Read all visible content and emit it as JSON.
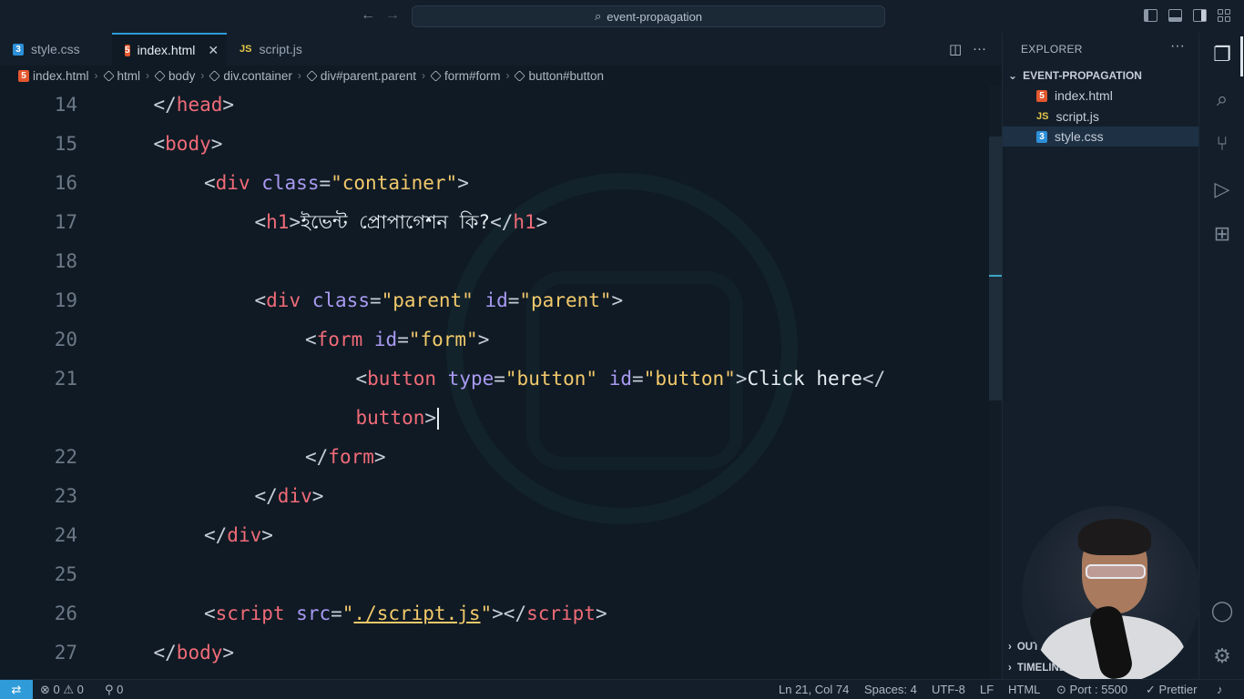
{
  "titlebar": {
    "search_text": "event-propagation"
  },
  "tabs": [
    {
      "label": "style.css",
      "icon": "css-file-icon"
    },
    {
      "label": "index.html",
      "icon": "html-file-icon",
      "active": true
    },
    {
      "label": "script.js",
      "icon": "js-file-icon"
    }
  ],
  "icons": {
    "html_glyph": "5",
    "css_glyph": "3",
    "js_glyph": "JS"
  },
  "breadcrumb": [
    "index.html",
    "html",
    "body",
    "div.container",
    "div#parent.parent",
    "form#form",
    "button#button"
  ],
  "editor": {
    "lines": [
      {
        "n": "14",
        "indent": 1,
        "tokens": [
          [
            "p",
            "</"
          ],
          [
            "t",
            "head"
          ],
          [
            "p",
            ">"
          ]
        ]
      },
      {
        "n": "15",
        "indent": 1,
        "tokens": [
          [
            "p",
            "<"
          ],
          [
            "t",
            "body"
          ],
          [
            "p",
            ">"
          ]
        ]
      },
      {
        "n": "16",
        "indent": 2,
        "tokens": [
          [
            "p",
            "<"
          ],
          [
            "t",
            "div"
          ],
          [
            "p",
            " "
          ],
          [
            "a",
            "class"
          ],
          [
            "p",
            "="
          ],
          [
            "s",
            "\"container\""
          ],
          [
            "p",
            ">"
          ]
        ]
      },
      {
        "n": "17",
        "indent": 3,
        "tokens": [
          [
            "p",
            "<"
          ],
          [
            "t",
            "h1"
          ],
          [
            "p",
            ">"
          ],
          [
            "x",
            "ইভেন্ট প্রোপাগেশন কি?"
          ],
          [
            "p",
            "</"
          ],
          [
            "t",
            "h1"
          ],
          [
            "p",
            ">"
          ]
        ]
      },
      {
        "n": "18",
        "indent": 0,
        "tokens": []
      },
      {
        "n": "19",
        "indent": 3,
        "tokens": [
          [
            "p",
            "<"
          ],
          [
            "t",
            "div"
          ],
          [
            "p",
            " "
          ],
          [
            "a",
            "class"
          ],
          [
            "p",
            "="
          ],
          [
            "s",
            "\"parent\""
          ],
          [
            "p",
            " "
          ],
          [
            "a",
            "id"
          ],
          [
            "p",
            "="
          ],
          [
            "s",
            "\"parent\""
          ],
          [
            "p",
            ">"
          ]
        ]
      },
      {
        "n": "20",
        "indent": 4,
        "tokens": [
          [
            "p",
            "<"
          ],
          [
            "t",
            "form"
          ],
          [
            "p",
            " "
          ],
          [
            "a",
            "id"
          ],
          [
            "p",
            "="
          ],
          [
            "s",
            "\"form\""
          ],
          [
            "p",
            ">"
          ]
        ]
      },
      {
        "n": "21",
        "indent": 5,
        "tokens": [
          [
            "p",
            "<"
          ],
          [
            "t",
            "button"
          ],
          [
            "p",
            " "
          ],
          [
            "a",
            "type"
          ],
          [
            "p",
            "="
          ],
          [
            "s",
            "\"button\""
          ],
          [
            "p",
            " "
          ],
          [
            "a",
            "id"
          ],
          [
            "p",
            "="
          ],
          [
            "s",
            "\"button\""
          ],
          [
            "p",
            ">"
          ],
          [
            "x",
            "Click here"
          ],
          [
            "p",
            "</"
          ]
        ]
      },
      {
        "n": "",
        "indent": 5,
        "tokens": [
          [
            "t",
            "button"
          ],
          [
            "p",
            ">"
          ]
        ],
        "cursor": true
      },
      {
        "n": "22",
        "indent": 4,
        "tokens": [
          [
            "p",
            "</"
          ],
          [
            "t",
            "form"
          ],
          [
            "p",
            ">"
          ]
        ]
      },
      {
        "n": "23",
        "indent": 3,
        "tokens": [
          [
            "p",
            "</"
          ],
          [
            "t",
            "div"
          ],
          [
            "p",
            ">"
          ]
        ]
      },
      {
        "n": "24",
        "indent": 2,
        "tokens": [
          [
            "p",
            "</"
          ],
          [
            "t",
            "div"
          ],
          [
            "p",
            ">"
          ]
        ]
      },
      {
        "n": "25",
        "indent": 0,
        "tokens": []
      },
      {
        "n": "26",
        "indent": 2,
        "tokens": [
          [
            "p",
            "<"
          ],
          [
            "t",
            "script"
          ],
          [
            "p",
            " "
          ],
          [
            "a",
            "src"
          ],
          [
            "p",
            "="
          ],
          [
            "s",
            "\""
          ],
          [
            "u",
            "./script.js"
          ],
          [
            "s",
            "\""
          ],
          [
            "p",
            "></"
          ],
          [
            "t",
            "script"
          ],
          [
            "p",
            ">"
          ]
        ]
      },
      {
        "n": "27",
        "indent": 1,
        "tokens": [
          [
            "p",
            "</"
          ],
          [
            "t",
            "body"
          ],
          [
            "p",
            ">"
          ]
        ]
      }
    ]
  },
  "explorer": {
    "title": "EXPLORER",
    "more": "···",
    "folder": "EVENT-PROPAGATION",
    "files": [
      {
        "name": "index.html",
        "type": "html"
      },
      {
        "name": "script.js",
        "type": "js"
      },
      {
        "name": "style.css",
        "type": "css",
        "selected": true
      }
    ],
    "sections": [
      "OUTLINE",
      "TIMELINE"
    ]
  },
  "statusbar": {
    "errors": "0",
    "warnings": "0",
    "ports": "0",
    "position": "Ln 21, Col 74",
    "spaces": "Spaces: 4",
    "encoding": "UTF-8",
    "eol": "LF",
    "language": "HTML",
    "port": "Port : 5500",
    "formatter": "Prettier"
  },
  "colors": {
    "accent": "#2f9bd8",
    "tag": "#f06b78",
    "attribute": "#a99af2",
    "string": "#f2c96b"
  }
}
